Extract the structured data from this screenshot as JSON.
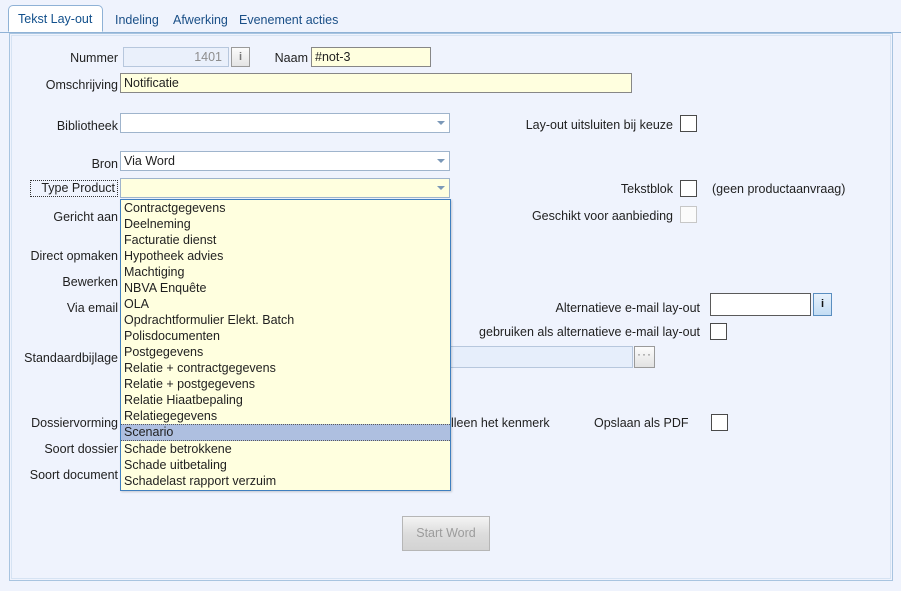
{
  "window": {
    "title": "Tekst Lay-out"
  },
  "tabs": [
    {
      "label": "Tekst Lay-out",
      "active": true
    },
    {
      "label": "Indeling",
      "active": false
    },
    {
      "label": "Afwerking",
      "active": false
    },
    {
      "label": "Evenement acties",
      "active": false
    }
  ],
  "form": {
    "nummer": {
      "label": "Nummer",
      "value": "1401"
    },
    "naam": {
      "label": "Naam",
      "value": "#not-3"
    },
    "omschrijving": {
      "label": "Omschrijving",
      "value": "Notificatie"
    },
    "bibliotheek": {
      "label": "Bibliotheek",
      "value": ""
    },
    "bron": {
      "label": "Bron",
      "value": "Via Word"
    },
    "type_product": {
      "label": "Type Product",
      "value": ""
    },
    "gericht_aan": {
      "label": "Gericht aan",
      "value": ""
    },
    "direct_opmaken": {
      "label": "Direct opmaken",
      "value": ""
    },
    "bewerken": {
      "label": "Bewerken",
      "value": ""
    },
    "via_email": {
      "label": "Via email",
      "value": ""
    },
    "standaardbijlage": {
      "label": "Standaardbijlage",
      "value": ""
    },
    "dossiervorming": {
      "label": "Dossiervorming",
      "value": ""
    },
    "soort_dossier": {
      "label": "Soort dossier",
      "value": ""
    },
    "soort_document": {
      "label": "Soort document",
      "value": ""
    }
  },
  "right": {
    "layout_uitsluiten": {
      "label": "Lay-out uitsluiten bij keuze",
      "checked": false
    },
    "tekstblok": {
      "label": "Tekstblok",
      "checked": false
    },
    "tekstblok_note": "(geen productaanvraag)",
    "geschikt_aanbieding": {
      "label": "Geschikt voor aanbieding",
      "checked": false,
      "disabled": true
    },
    "alt_email_layout": {
      "label": "Alternatieve e-mail lay-out",
      "value": ""
    },
    "gebruiken_als_alt": {
      "label": "gebruiken als alternatieve e-mail lay-out",
      "checked": false
    },
    "alleen_kenmerk": {
      "label": "lleen het kenmerk"
    },
    "opslaan_pdf": {
      "label": "Opslaan als PDF",
      "checked": false
    }
  },
  "buttons": {
    "start_word": "Start Word",
    "info": "i",
    "browse": "···"
  },
  "dropdown": {
    "open": true,
    "selected": "Scenario",
    "options": [
      "Contractgegevens",
      "Deelneming",
      "Facturatie dienst",
      "Hypotheek advies",
      "Machtiging",
      "NBVA Enquête",
      "OLA",
      "Opdrachtformulier Elekt. Batch",
      "Polisdocumenten",
      "Postgegevens",
      "Relatie + contractgegevens",
      "Relatie + postgegevens",
      "Relatie Hiaatbepaling",
      "Relatiegegevens",
      "Scenario",
      "Schade betrokkene",
      "Schade uitbetaling",
      "Schadelast rapport verzuim"
    ]
  },
  "colors": {
    "background": "#eff3fd",
    "field_yellow": "#ffffdf",
    "selection": "#aebfe0",
    "tab_text": "#1a4f87",
    "border": "#a8c4e0"
  }
}
